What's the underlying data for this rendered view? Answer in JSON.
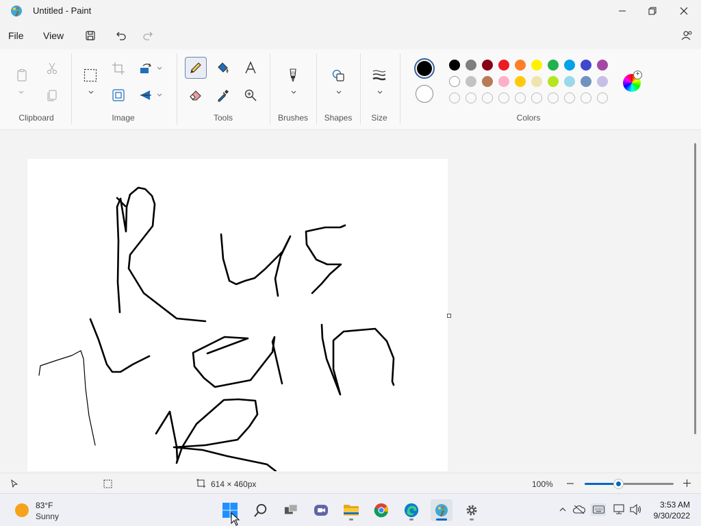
{
  "window": {
    "title": "Untitled - Paint",
    "minimize_icon": "minimize-icon",
    "maximize_icon": "restore-icon",
    "close_icon": "close-icon"
  },
  "menu": {
    "file": "File",
    "view": "View"
  },
  "ribbon": {
    "groups": {
      "clipboard": "Clipboard",
      "image": "Image",
      "tools": "Tools",
      "brushes": "Brushes",
      "shapes": "Shapes",
      "size": "Size",
      "colors": "Colors"
    },
    "selected_tool": "pencil",
    "palette_row1": [
      "#000000",
      "#7f7f7f",
      "#880015",
      "#ed1c24",
      "#ff7f27",
      "#fff200",
      "#22b14c",
      "#00a2e8",
      "#3f48cc",
      "#a349a4"
    ],
    "palette_row2": [
      "#ffffff",
      "#c3c3c3",
      "#b97a57",
      "#ffaec9",
      "#ffc90e",
      "#efe4b0",
      "#b5e61d",
      "#99d9ea",
      "#7092be",
      "#c8bfe7"
    ],
    "palette_row3_empty": 10,
    "primary_color": "#000000",
    "secondary_color": "#ffffff"
  },
  "status": {
    "canvas_size": "614 × 460px",
    "zoom": "100%",
    "zoom_fraction": 0.38
  },
  "taskbar": {
    "weather_temp": "83°F",
    "weather_desc": "Sunny",
    "time": "3:53 AM",
    "date": "9/30/2022"
  }
}
